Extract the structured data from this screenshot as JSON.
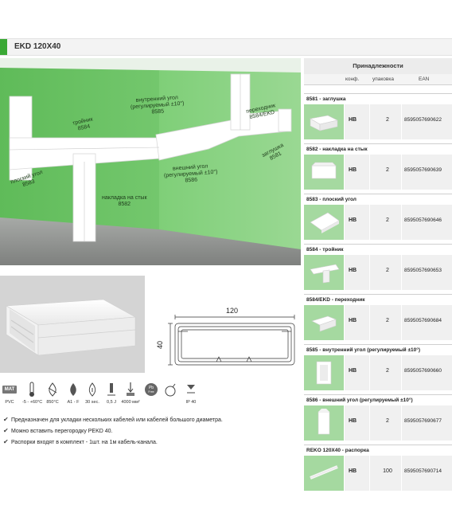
{
  "header": {
    "title": "EKD 120X40"
  },
  "hero_labels": {
    "l8583": "плоский угол\n8583",
    "l8584": "тройник\n8584",
    "l8585": "внутренний угол\n(регулируемый ±10°)\n8585",
    "l8584ekd": "переходник\n8584/EKD",
    "l8581": "заглушка\n8581",
    "l8586": "внешний угол\n(регулируемый ±10°)\n8586",
    "l8582": "накладка на стык\n8582"
  },
  "drawing": {
    "width_label": "120",
    "height_label": "40"
  },
  "specs": [
    {
      "icon": "mat-badge",
      "text": "PVC"
    },
    {
      "icon": "thermometer-icon",
      "text": "-5 - +60°C"
    },
    {
      "icon": "glow-wire-icon",
      "text": "850°C"
    },
    {
      "icon": "flame-icon",
      "text": "A1 - F"
    },
    {
      "icon": "flame-timer-icon",
      "text": "30 sec."
    },
    {
      "icon": "impact-icon",
      "text": "0,5 J"
    },
    {
      "icon": "compression-icon",
      "text": "4000 мм²"
    },
    {
      "icon": "pb-free-icon",
      "text": ""
    },
    {
      "icon": "bomb-icon",
      "text": ""
    },
    {
      "icon": "ip-icon",
      "text": "IP 40"
    }
  ],
  "mat_label": "MAT",
  "features": [
    "Предназначен для укладки нескольких кабелей или кабелей большого диаметра.",
    "Можно вставить перегородку PEKD 40.",
    "Распорки входят в комплект - 1шт. на 1м кабель-канала."
  ],
  "accessories": {
    "title": "Принадлежности",
    "col_conf": "конф.",
    "col_pack": "упаковка",
    "col_ean": "EAN",
    "items": [
      {
        "title": "8581 - заглушка",
        "conf": "HB",
        "pack": "2",
        "ean": "8595057690622"
      },
      {
        "title": "8582 - накладка на стык",
        "conf": "HB",
        "pack": "2",
        "ean": "8595057690639"
      },
      {
        "title": "8583 - плоский угол",
        "conf": "HB",
        "pack": "2",
        "ean": "8595057690646"
      },
      {
        "title": "8584 - тройник",
        "conf": "HB",
        "pack": "2",
        "ean": "8595057690653"
      },
      {
        "title": "8584/EKD - переходник",
        "conf": "HB",
        "pack": "2",
        "ean": "8595057690684"
      },
      {
        "title": "8585 - внутренний угол (регулируемый ±10°)",
        "conf": "HB",
        "pack": "2",
        "ean": "8595057690660"
      },
      {
        "title": "8586 - внешний угол (регулируемый ±10°)",
        "conf": "HB",
        "pack": "2",
        "ean": "8595057690677"
      },
      {
        "title": "REKO 120X40 - распорка",
        "conf": "HB",
        "pack": "100",
        "ean": "8595057690714"
      }
    ]
  }
}
